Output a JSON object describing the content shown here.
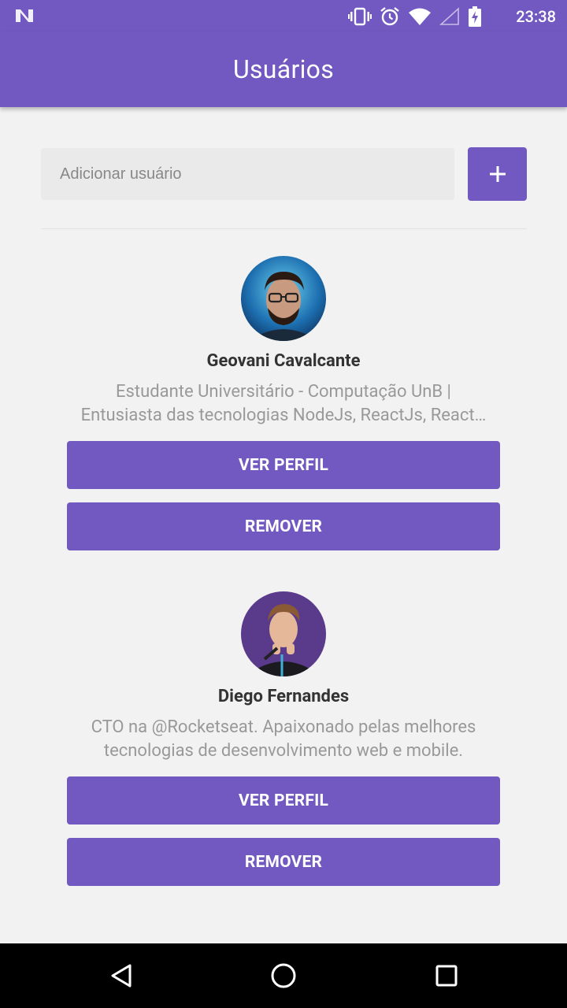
{
  "status_bar": {
    "time": "23:38",
    "icons": [
      "n-logo-icon",
      "vibrate-icon",
      "alarm-icon",
      "wifi-icon",
      "signal-icon",
      "battery-charging-icon"
    ]
  },
  "app_bar": {
    "title": "Usuários"
  },
  "add_user": {
    "placeholder": "Adicionar usuário",
    "value": "",
    "button_icon": "plus-icon"
  },
  "users": [
    {
      "name": "Geovani Cavalcante",
      "bio_line1": "Estudante Universitário - Computação UnB |",
      "bio_line2": "Entusiasta das tecnologias NodeJs, ReactJs, React…",
      "view_label": "VER PERFIL",
      "remove_label": "REMOVER"
    },
    {
      "name": "Diego Fernandes",
      "bio_line1": "CTO na @Rocketseat. Apaixonado pelas melhores",
      "bio_line2": "tecnologias de desenvolvimento web e mobile.",
      "view_label": "VER PERFIL",
      "remove_label": "REMOVER"
    }
  ],
  "nav_bar": {
    "icons": [
      "back-icon",
      "home-icon",
      "recents-icon"
    ]
  },
  "colors": {
    "primary": "#7159c1",
    "background": "#f2f2f2",
    "bio_text": "#999999",
    "name_text": "#333333"
  }
}
